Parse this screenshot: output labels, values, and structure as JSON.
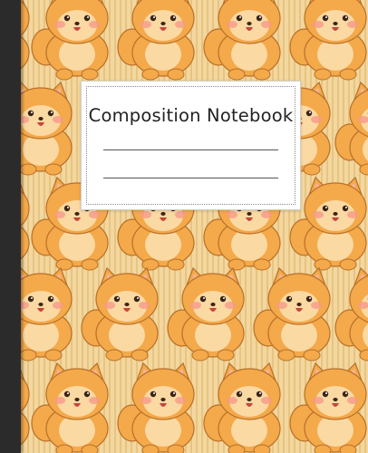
{
  "cover": {
    "title": "Composition Notebook",
    "pattern_subject": "pomeranian-dog-icon",
    "colors": {
      "background": "#f2d7a0",
      "stripe": "#e8c47f",
      "fur": "#f4a94a",
      "fur_light": "#fbd9a3",
      "outline": "#b8702a",
      "spine": "#2b2b2b",
      "label": "#ffffff"
    }
  }
}
